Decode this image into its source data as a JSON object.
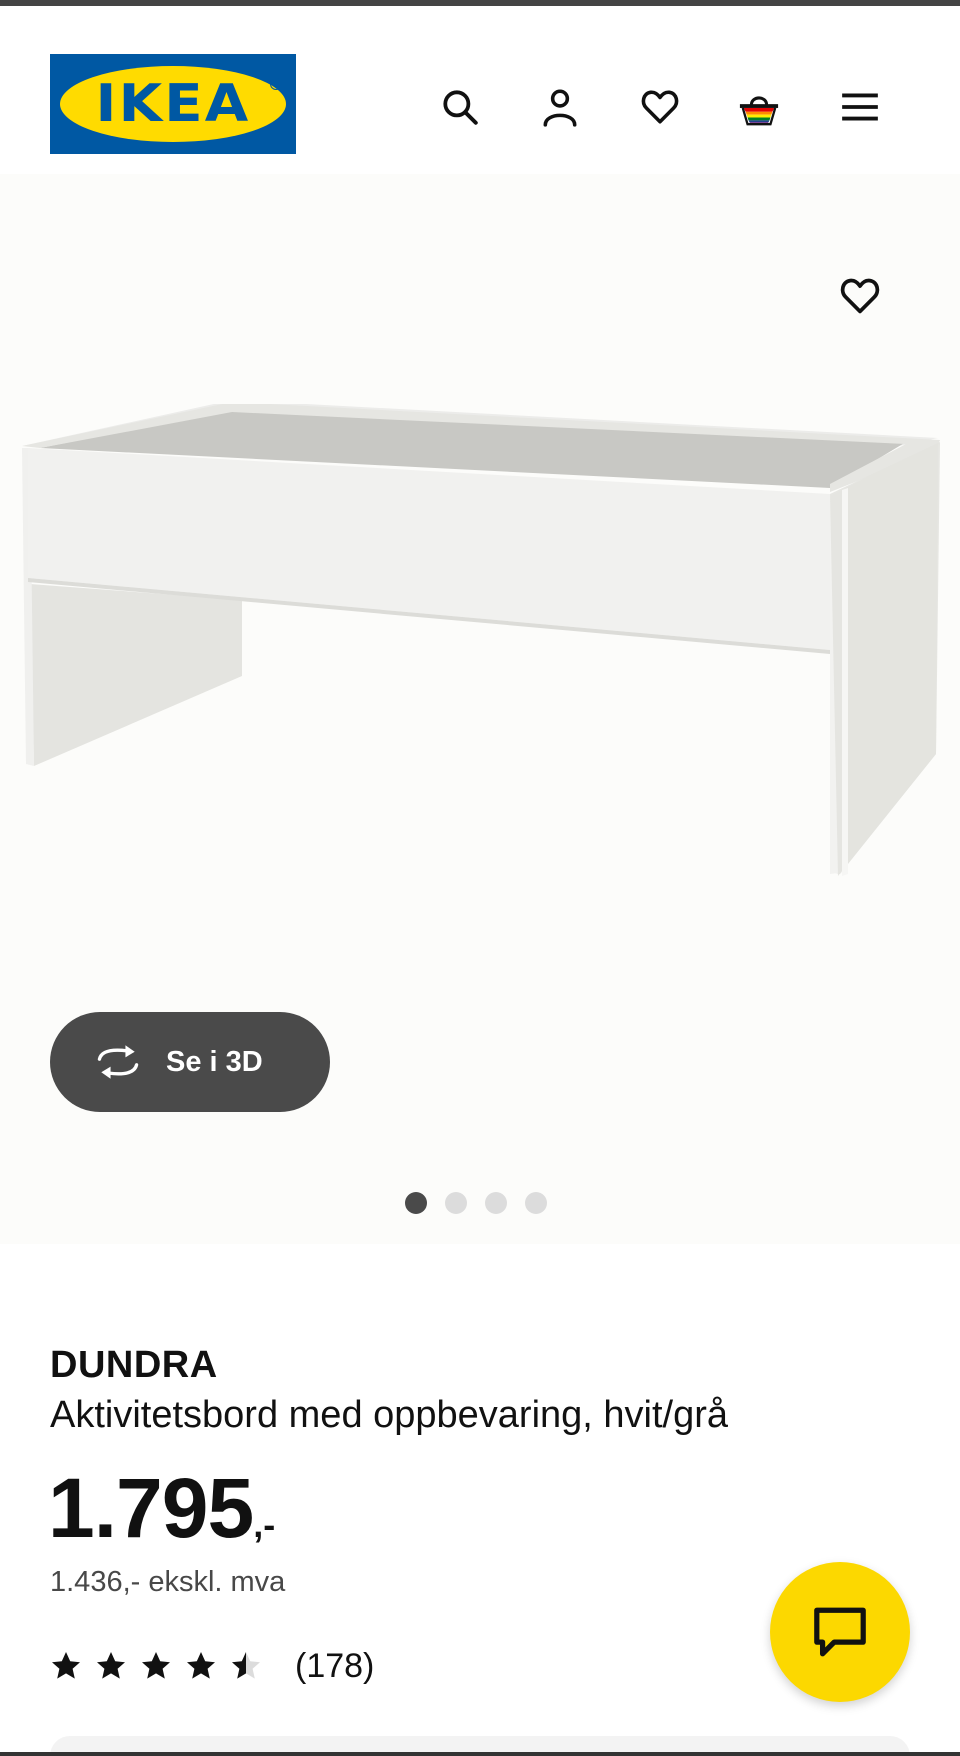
{
  "header": {
    "logo_text": "IKEA",
    "brand_blue": "#0058a3",
    "brand_yellow": "#ffdb00",
    "icons": [
      "search-icon",
      "account-icon",
      "heart-icon",
      "basket-icon",
      "menu-icon"
    ]
  },
  "gallery": {
    "view_3d_label": "Se i 3D",
    "slide_count": 4,
    "active_slide": 1
  },
  "product": {
    "name": "DUNDRA",
    "description": "Aktivitetsbord med oppbevaring, hvit/grå",
    "price_integer": "1.795",
    "price_suffix": ",-",
    "price_excl_vat": "1.436,- ekskl. mva",
    "rating_value": 4.5,
    "rating_max": 5,
    "review_count": "(178)"
  },
  "chat": {
    "icon": "chat-icon",
    "color": "#fcd800"
  }
}
